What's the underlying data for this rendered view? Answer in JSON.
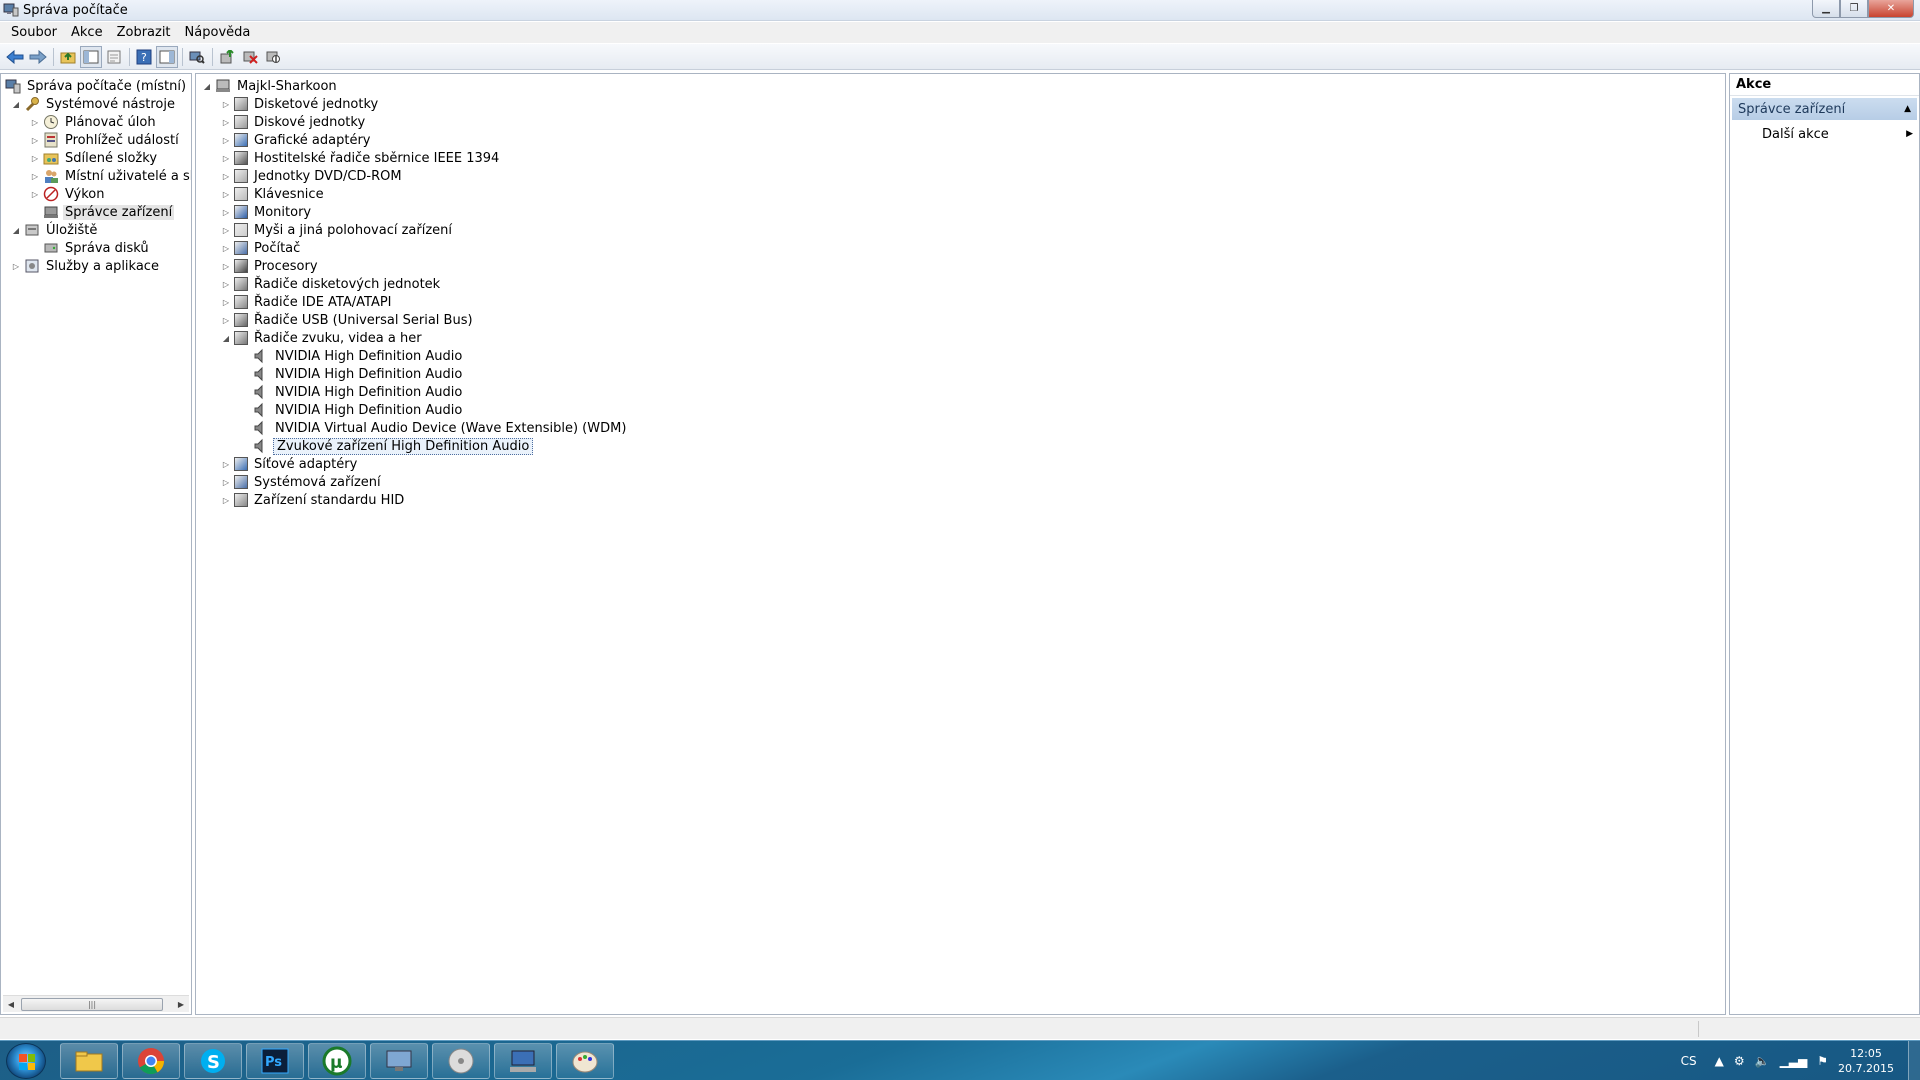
{
  "window": {
    "title": "Správa počítače"
  },
  "menu": [
    "Soubor",
    "Akce",
    "Zobrazit",
    "Nápověda"
  ],
  "toolbar": [
    "back-icon",
    "forward-icon",
    "up-folder-icon",
    "show-hide-tree-icon",
    "export-icon",
    "help-icon",
    "show-hide-action-pane-icon",
    "scan-hardware-icon",
    "update-driver-icon",
    "uninstall-icon",
    "disable-icon"
  ],
  "left_tree": [
    {
      "label": "Správa počítače (místní)",
      "icon": "computer-management-icon",
      "expander": "",
      "level": 0
    },
    {
      "label": "Systémové nástroje",
      "icon": "tools-icon",
      "expander": "◢",
      "level": 1
    },
    {
      "label": "Plánovač úloh",
      "icon": "clock-icon",
      "expander": "▷",
      "level": 2
    },
    {
      "label": "Prohlížeč událostí",
      "icon": "event-viewer-icon",
      "expander": "▷",
      "level": 2
    },
    {
      "label": "Sdílené složky",
      "icon": "shared-folder-icon",
      "expander": "▷",
      "level": 2
    },
    {
      "label": "Místní uživatelé a skupiny",
      "icon": "users-icon",
      "expander": "▷",
      "level": 2
    },
    {
      "label": "Výkon",
      "icon": "performance-icon",
      "expander": "▷",
      "level": 2
    },
    {
      "label": "Správce zařízení",
      "icon": "device-manager-icon",
      "expander": "",
      "level": 2,
      "selected": true
    },
    {
      "label": "Úložiště",
      "icon": "storage-icon",
      "expander": "◢",
      "level": 1
    },
    {
      "label": "Správa disků",
      "icon": "disk-icon",
      "expander": "",
      "level": 2
    },
    {
      "label": "Služby a aplikace",
      "icon": "services-icon",
      "expander": "▷",
      "level": 1
    }
  ],
  "device_tree": {
    "root": "Majkl-Sharkoon",
    "categories": [
      {
        "label": "Disketové jednotky",
        "icon": "floppy-drive-icon",
        "expander": "▷"
      },
      {
        "label": "Diskové jednotky",
        "icon": "hard-disk-icon",
        "expander": "▷"
      },
      {
        "label": "Grafické adaptéry",
        "icon": "display-adapter-icon",
        "expander": "▷"
      },
      {
        "label": "Hostitelské řadiče sběrnice IEEE 1394",
        "icon": "ieee1394-icon",
        "expander": "▷"
      },
      {
        "label": "Jednotky DVD/CD-ROM",
        "icon": "dvd-drive-icon",
        "expander": "▷"
      },
      {
        "label": "Klávesnice",
        "icon": "keyboard-icon",
        "expander": "▷"
      },
      {
        "label": "Monitory",
        "icon": "monitor-icon",
        "expander": "▷"
      },
      {
        "label": "Myši a jiná polohovací zařízení",
        "icon": "mouse-icon",
        "expander": "▷"
      },
      {
        "label": "Počítač",
        "icon": "computer-icon",
        "expander": "▷"
      },
      {
        "label": "Procesory",
        "icon": "processor-icon",
        "expander": "▷"
      },
      {
        "label": "Řadiče disketových jednotek",
        "icon": "floppy-controller-icon",
        "expander": "▷"
      },
      {
        "label": "Řadiče IDE ATA/ATAPI",
        "icon": "ide-controller-icon",
        "expander": "▷"
      },
      {
        "label": "Řadiče USB (Universal Serial Bus)",
        "icon": "usb-icon",
        "expander": "▷"
      },
      {
        "label": "Řadiče zvuku, videa a her",
        "icon": "speaker-icon",
        "expander": "◢",
        "children": [
          {
            "label": "NVIDIA High Definition Audio",
            "icon": "speaker-icon"
          },
          {
            "label": "NVIDIA High Definition Audio",
            "icon": "speaker-icon"
          },
          {
            "label": "NVIDIA High Definition Audio",
            "icon": "speaker-icon"
          },
          {
            "label": "NVIDIA High Definition Audio",
            "icon": "speaker-icon"
          },
          {
            "label": "NVIDIA Virtual Audio Device (Wave Extensible) (WDM)",
            "icon": "speaker-icon"
          },
          {
            "label": "Zvukové zařízení High Definition Audio",
            "icon": "speaker-icon",
            "selected": true
          }
        ]
      },
      {
        "label": "Síťové adaptéry",
        "icon": "network-adapter-icon",
        "expander": "▷"
      },
      {
        "label": "Systémová zařízení",
        "icon": "system-device-icon",
        "expander": "▷"
      },
      {
        "label": "Zařízení standardu HID",
        "icon": "hid-icon",
        "expander": "▷"
      }
    ]
  },
  "actions": {
    "header": "Akce",
    "section": "Správce zařízení",
    "items": [
      "Další akce"
    ]
  },
  "taskbar": {
    "apps": [
      "explorer-icon",
      "chrome-icon",
      "skype-icon",
      "photoshop-icon",
      "utorrent-icon",
      "computer-management-icon",
      "media-player-icon",
      "network-icon",
      "paint-icon"
    ],
    "language": "CS",
    "time": "12:05",
    "date": "20.7.2015"
  },
  "colors": {
    "taskbar": "#1a6d97",
    "selection_border": "#4f6e9f",
    "action_section": "#c4d6ea"
  }
}
